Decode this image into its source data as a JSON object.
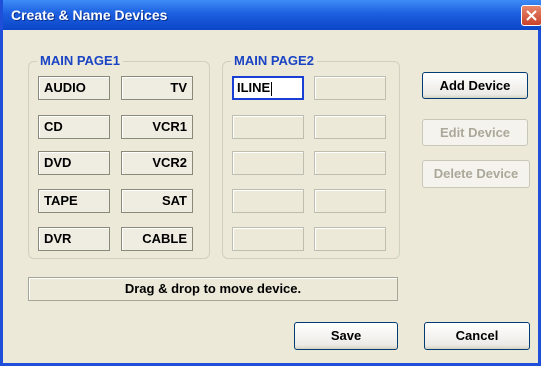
{
  "window": {
    "title": "Create & Name Devices"
  },
  "page1": {
    "legend": "MAIN PAGE1",
    "devices": [
      {
        "label": "AUDIO",
        "align": "left"
      },
      {
        "label": "TV",
        "align": "right"
      },
      {
        "label": "CD",
        "align": "left"
      },
      {
        "label": "VCR1",
        "align": "right"
      },
      {
        "label": "DVD",
        "align": "left"
      },
      {
        "label": "VCR2",
        "align": "right"
      },
      {
        "label": "TAPE",
        "align": "left"
      },
      {
        "label": "SAT",
        "align": "right"
      },
      {
        "label": "DVR",
        "align": "left"
      },
      {
        "label": "CABLE",
        "align": "right"
      }
    ]
  },
  "page2": {
    "legend": "MAIN PAGE2",
    "devices": [
      {
        "label": "ILINE",
        "active": true
      },
      {
        "label": ""
      },
      {
        "label": ""
      },
      {
        "label": ""
      },
      {
        "label": ""
      },
      {
        "label": ""
      },
      {
        "label": ""
      },
      {
        "label": ""
      },
      {
        "label": ""
      },
      {
        "label": ""
      }
    ]
  },
  "actions": {
    "add": "Add Device",
    "edit": "Edit Device",
    "delete": "Delete Device"
  },
  "status": "Drag & drop to move device.",
  "footer": {
    "save": "Save",
    "cancel": "Cancel"
  },
  "colors": {
    "title_bar": "#0b46c8",
    "legend": "#1a44c4",
    "close": "#c8422a",
    "active_border": "#1a3fd6"
  }
}
